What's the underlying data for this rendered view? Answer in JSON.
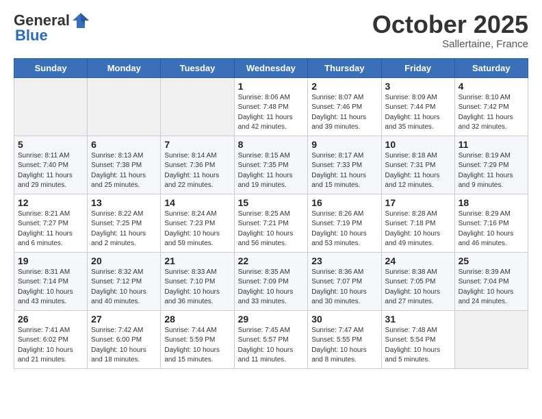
{
  "header": {
    "logo_general": "General",
    "logo_blue": "Blue",
    "month": "October 2025",
    "location": "Sallertaine, France"
  },
  "days_of_week": [
    "Sunday",
    "Monday",
    "Tuesday",
    "Wednesday",
    "Thursday",
    "Friday",
    "Saturday"
  ],
  "weeks": [
    [
      {
        "day": "",
        "info": ""
      },
      {
        "day": "",
        "info": ""
      },
      {
        "day": "",
        "info": ""
      },
      {
        "day": "1",
        "info": "Sunrise: 8:06 AM\nSunset: 7:48 PM\nDaylight: 11 hours\nand 42 minutes."
      },
      {
        "day": "2",
        "info": "Sunrise: 8:07 AM\nSunset: 7:46 PM\nDaylight: 11 hours\nand 39 minutes."
      },
      {
        "day": "3",
        "info": "Sunrise: 8:09 AM\nSunset: 7:44 PM\nDaylight: 11 hours\nand 35 minutes."
      },
      {
        "day": "4",
        "info": "Sunrise: 8:10 AM\nSunset: 7:42 PM\nDaylight: 11 hours\nand 32 minutes."
      }
    ],
    [
      {
        "day": "5",
        "info": "Sunrise: 8:11 AM\nSunset: 7:40 PM\nDaylight: 11 hours\nand 29 minutes."
      },
      {
        "day": "6",
        "info": "Sunrise: 8:13 AM\nSunset: 7:38 PM\nDaylight: 11 hours\nand 25 minutes."
      },
      {
        "day": "7",
        "info": "Sunrise: 8:14 AM\nSunset: 7:36 PM\nDaylight: 11 hours\nand 22 minutes."
      },
      {
        "day": "8",
        "info": "Sunrise: 8:15 AM\nSunset: 7:35 PM\nDaylight: 11 hours\nand 19 minutes."
      },
      {
        "day": "9",
        "info": "Sunrise: 8:17 AM\nSunset: 7:33 PM\nDaylight: 11 hours\nand 15 minutes."
      },
      {
        "day": "10",
        "info": "Sunrise: 8:18 AM\nSunset: 7:31 PM\nDaylight: 11 hours\nand 12 minutes."
      },
      {
        "day": "11",
        "info": "Sunrise: 8:19 AM\nSunset: 7:29 PM\nDaylight: 11 hours\nand 9 minutes."
      }
    ],
    [
      {
        "day": "12",
        "info": "Sunrise: 8:21 AM\nSunset: 7:27 PM\nDaylight: 11 hours\nand 6 minutes."
      },
      {
        "day": "13",
        "info": "Sunrise: 8:22 AM\nSunset: 7:25 PM\nDaylight: 11 hours\nand 2 minutes."
      },
      {
        "day": "14",
        "info": "Sunrise: 8:24 AM\nSunset: 7:23 PM\nDaylight: 10 hours\nand 59 minutes."
      },
      {
        "day": "15",
        "info": "Sunrise: 8:25 AM\nSunset: 7:21 PM\nDaylight: 10 hours\nand 56 minutes."
      },
      {
        "day": "16",
        "info": "Sunrise: 8:26 AM\nSunset: 7:19 PM\nDaylight: 10 hours\nand 53 minutes."
      },
      {
        "day": "17",
        "info": "Sunrise: 8:28 AM\nSunset: 7:18 PM\nDaylight: 10 hours\nand 49 minutes."
      },
      {
        "day": "18",
        "info": "Sunrise: 8:29 AM\nSunset: 7:16 PM\nDaylight: 10 hours\nand 46 minutes."
      }
    ],
    [
      {
        "day": "19",
        "info": "Sunrise: 8:31 AM\nSunset: 7:14 PM\nDaylight: 10 hours\nand 43 minutes."
      },
      {
        "day": "20",
        "info": "Sunrise: 8:32 AM\nSunset: 7:12 PM\nDaylight: 10 hours\nand 40 minutes."
      },
      {
        "day": "21",
        "info": "Sunrise: 8:33 AM\nSunset: 7:10 PM\nDaylight: 10 hours\nand 36 minutes."
      },
      {
        "day": "22",
        "info": "Sunrise: 8:35 AM\nSunset: 7:09 PM\nDaylight: 10 hours\nand 33 minutes."
      },
      {
        "day": "23",
        "info": "Sunrise: 8:36 AM\nSunset: 7:07 PM\nDaylight: 10 hours\nand 30 minutes."
      },
      {
        "day": "24",
        "info": "Sunrise: 8:38 AM\nSunset: 7:05 PM\nDaylight: 10 hours\nand 27 minutes."
      },
      {
        "day": "25",
        "info": "Sunrise: 8:39 AM\nSunset: 7:04 PM\nDaylight: 10 hours\nand 24 minutes."
      }
    ],
    [
      {
        "day": "26",
        "info": "Sunrise: 7:41 AM\nSunset: 6:02 PM\nDaylight: 10 hours\nand 21 minutes."
      },
      {
        "day": "27",
        "info": "Sunrise: 7:42 AM\nSunset: 6:00 PM\nDaylight: 10 hours\nand 18 minutes."
      },
      {
        "day": "28",
        "info": "Sunrise: 7:44 AM\nSunset: 5:59 PM\nDaylight: 10 hours\nand 15 minutes."
      },
      {
        "day": "29",
        "info": "Sunrise: 7:45 AM\nSunset: 5:57 PM\nDaylight: 10 hours\nand 11 minutes."
      },
      {
        "day": "30",
        "info": "Sunrise: 7:47 AM\nSunset: 5:55 PM\nDaylight: 10 hours\nand 8 minutes."
      },
      {
        "day": "31",
        "info": "Sunrise: 7:48 AM\nSunset: 5:54 PM\nDaylight: 10 hours\nand 5 minutes."
      },
      {
        "day": "",
        "info": ""
      }
    ]
  ]
}
